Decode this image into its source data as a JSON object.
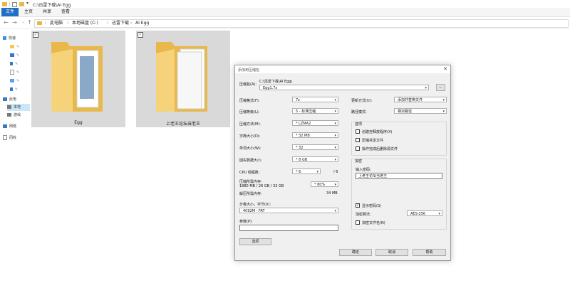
{
  "window": {
    "title": "C:\\迅雷下载\\AI Egg"
  },
  "ribbon": {
    "tabs": [
      "文件",
      "主页",
      "共享",
      "查看"
    ]
  },
  "address": {
    "crumbs": [
      "此电脑",
      "本地磁盘 (C:)",
      "迅雷下载",
      "AI Egg"
    ]
  },
  "nav": {
    "quick_access": "快速",
    "items": [
      "",
      "",
      "",
      "",
      "",
      ""
    ],
    "this_pc": "此电",
    "pc_items": [
      "本地",
      "游戏"
    ],
    "network": "网络",
    "recycle": "回收"
  },
  "tiles": [
    {
      "label": "Egg"
    },
    {
      "label": "上老王论坛当老王"
    }
  ],
  "dialog": {
    "title": "添加到压缩包",
    "archive_label": "压缩包(A):",
    "archive_path": "C:\\迅雷下载\\AI Egg\\",
    "archive_name": "Egg1.7z",
    "browse_label": "...",
    "format_label": "压缩格式(F):",
    "format_value": "7z",
    "level_label": "压缩等级(L):",
    "level_value": "5 - 标准压缩",
    "method_label": "压缩方法(M):",
    "method_value": "* LZMA2",
    "dict_label": "字典大小(D):",
    "dict_value": "* 32 MB",
    "word_label": "单词大小(W):",
    "word_value": "* 32",
    "solid_label": "固实数据大小:",
    "solid_value": "* 8 GB",
    "cpu_label": "CPU 线程数:",
    "cpu_value": "* 6",
    "cpu_total": "/ 6",
    "mem_compress_label": "压缩所需内存:",
    "mem_compress_value": "1880 MB / 26 GB / 32 GB",
    "mem_percent": "* 80%",
    "mem_decompress_label": "解压所需内存:",
    "mem_decompress_value": "34 MB",
    "split_label": "分卷大小，字节(V):",
    "split_value": "4092M - FAT",
    "params_label": "参数(P):",
    "params_value": "",
    "options_button": "选项",
    "update_label": "更新方式(U):",
    "update_value": "添加并替换文件",
    "path_label": "路径模式:",
    "path_value": "相对路径",
    "options_group": "选项",
    "opt_sfx": "创建自释放程序(X)",
    "opt_shared": "压缩共享文件",
    "opt_delete": "操作完成后删除源文件",
    "encrypt_group": "加密",
    "password_label": "输入密码:",
    "password_value": "上老王论坛当老王",
    "show_password": "显示密码(S)",
    "encrypt_method_label": "加密算法:",
    "encrypt_method_value": "AES-256",
    "encrypt_names": "加密文件名(N)",
    "ok": "确定",
    "cancel": "取消",
    "help": "帮助"
  }
}
